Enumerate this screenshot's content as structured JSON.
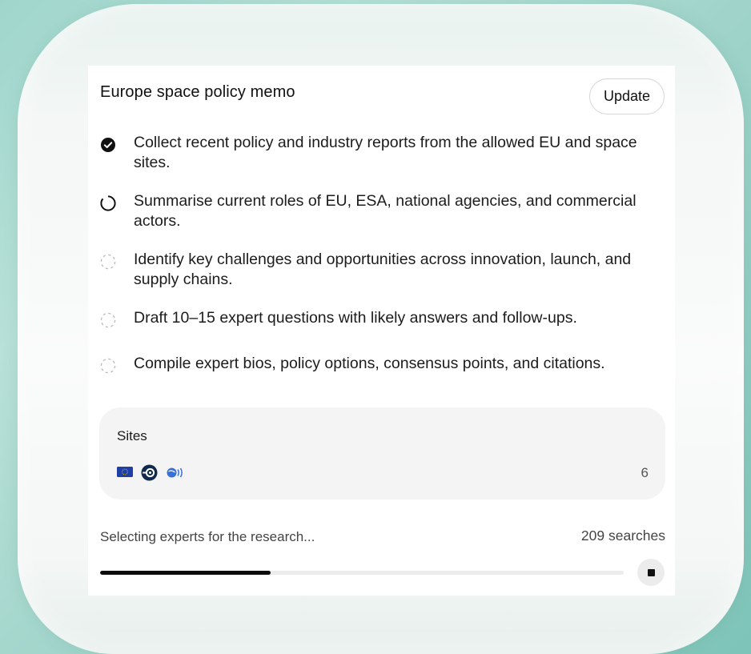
{
  "memo": {
    "title": "Europe space policy memo",
    "update_label": "Update"
  },
  "tasks": [
    {
      "text": "Collect recent policy and industry reports from the allowed EU and space sites.",
      "status": "done"
    },
    {
      "text": "Summarise current roles of EU, ESA, national agencies, and commercial actors.",
      "status": "in-progress"
    },
    {
      "text": "Identify key challenges and opportunities across innovation, launch, and supply chains.",
      "status": "pending"
    },
    {
      "text": "Draft 10–15 expert questions with likely answers and follow-ups.",
      "status": "pending"
    },
    {
      "text": "Compile expert bios, policy options, consensus points, and citations.",
      "status": "pending"
    }
  ],
  "sites": {
    "label": "Sites",
    "icons": [
      "eu-flag-icon",
      "esa-logo-icon",
      "space-globe-icon"
    ],
    "count": "6"
  },
  "progress": {
    "status_text": "Selecting experts for the research...",
    "searches": "209 searches",
    "fraction": 0.325
  },
  "colors": {
    "accent": "#0d0d0d",
    "eu_blue": "#1f3fa8",
    "eu_gold": "#f5c400",
    "globe_blue": "#3a6fd8"
  }
}
